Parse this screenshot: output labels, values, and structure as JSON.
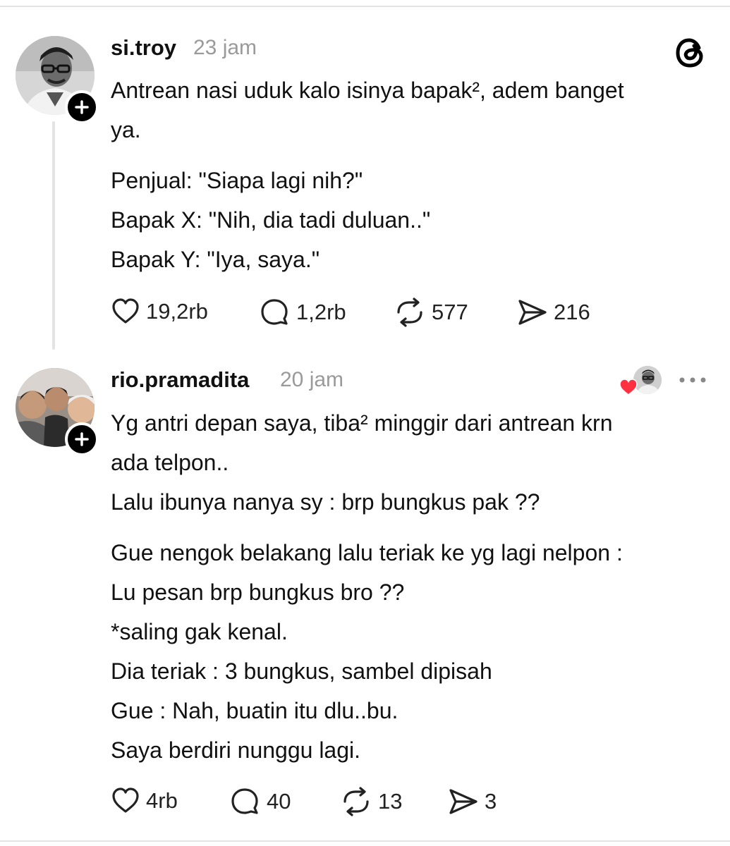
{
  "posts": [
    {
      "username": "si.troy",
      "time": "23 jam",
      "body": [
        "Antrean nasi uduk kalo isinya bapak², adem banget",
        "ya.",
        "",
        "Penjual: \"Siapa lagi nih?\"",
        "Bapak X: \"Nih, dia tadi duluan..\"",
        "Bapak Y: \"Iya, saya.\""
      ],
      "likes": "19,2rb",
      "replies": "1,2rb",
      "reposts": "577",
      "shares": "216"
    },
    {
      "username": "rio.pramadita",
      "time": "20 jam",
      "body": [
        "Yg antri depan saya, tiba² minggir dari antrean krn",
        "ada telpon..",
        "Lalu ibunya nanya sy : brp bungkus pak ??",
        "",
        "Gue nengok belakang lalu teriak ke yg lagi nelpon :",
        "Lu pesan brp bungkus bro ??",
        "*saling gak kenal.",
        "Dia teriak : 3 bungkus, sambel dipisah",
        "Gue : Nah, buatin itu dlu..bu.",
        "Saya berdiri nunggu lagi."
      ],
      "likes": "4rb",
      "replies": "40",
      "reposts": "13",
      "shares": "3"
    }
  ],
  "colors": {
    "text": "#111111",
    "muted": "#9a9a9a",
    "heart": "#ff3040",
    "badge": "#000000"
  },
  "icons": [
    "threads-logo-icon",
    "heart-icon",
    "comment-icon",
    "repost-icon",
    "share-icon",
    "plus-icon",
    "more-icon"
  ]
}
